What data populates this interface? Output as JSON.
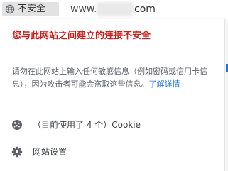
{
  "address_bar": {
    "security_label": "不安全",
    "url_prefix": "www.",
    "url_suffix": "com"
  },
  "popup": {
    "heading": "您与此网站之间建立的连接不安全",
    "body_text": "请勿在此网站上输入任何敏感信息（例如密码或信用卡信息），因为攻击者可能会盗取这些信息。",
    "learn_more": "了解详情",
    "cookies_label": "（目前使用了 4 个）Cookie",
    "site_settings_label": "网站设置"
  },
  "colors": {
    "warning_red": "#c5221f",
    "link_blue": "#1a73e8",
    "chip_gray": "#e2e2e2"
  },
  "icons": {
    "security": "globe-icon",
    "cookies": "cookie-icon",
    "settings": "gear-icon"
  }
}
